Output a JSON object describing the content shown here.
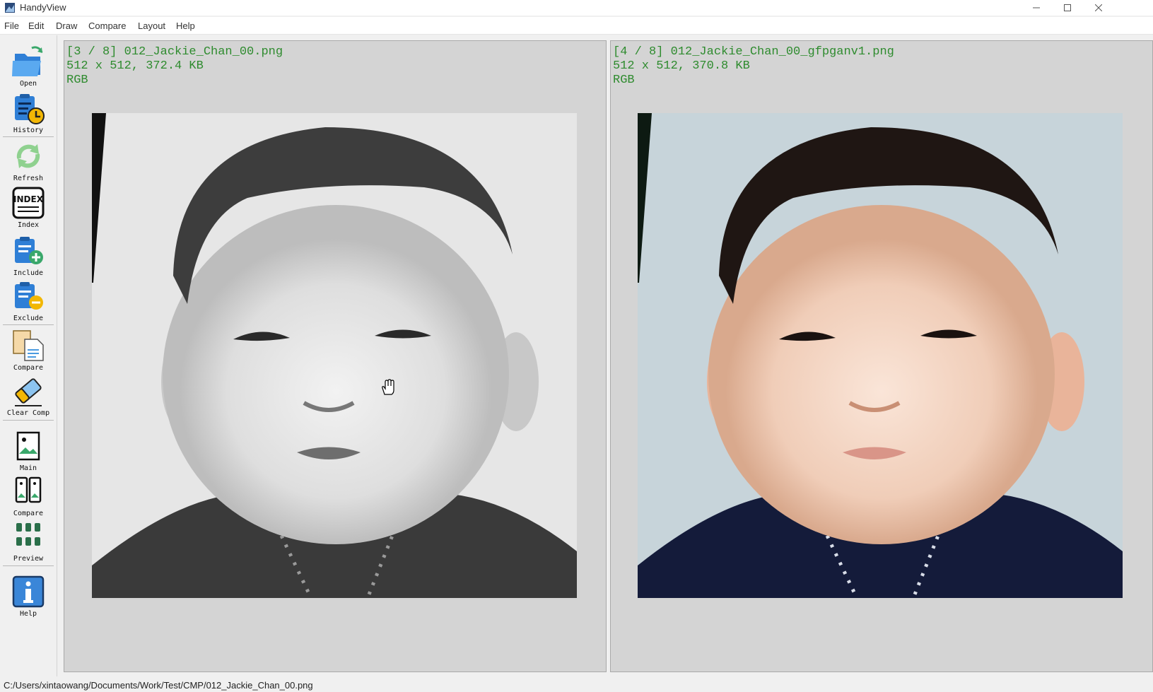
{
  "window": {
    "title": "HandyView"
  },
  "menu": [
    "File",
    "Edit",
    "Draw",
    "Compare",
    "Layout",
    "Help"
  ],
  "toolbar": {
    "open": "Open",
    "history": "History",
    "refresh": "Refresh",
    "index": "Index",
    "include": "Include",
    "exclude": "Exclude",
    "compare": "Compare",
    "clear_comp": "Clear Comp",
    "main": "Main",
    "compare_view": "Compare",
    "preview": "Preview",
    "help": "Help",
    "index_icon_text": "INDEX"
  },
  "left_panel": {
    "line1": "[3 / 8] 012_Jackie_Chan_00.png",
    "line2": "512 x 512, 372.4 KB",
    "line3": "RGB"
  },
  "right_panel": {
    "line1": "[4 / 8] 012_Jackie_Chan_00_gfpganv1.png",
    "line2": "512 x 512, 370.8 KB",
    "line3": "RGB"
  },
  "status": {
    "path": "C:/Users/xintaowang/Documents/Work/Test/CMP/012_Jackie_Chan_00.png"
  },
  "colors": {
    "info_text": "#2e8b2e",
    "panel_bg": "#d4d4d4",
    "accent": "#3a86d8"
  }
}
